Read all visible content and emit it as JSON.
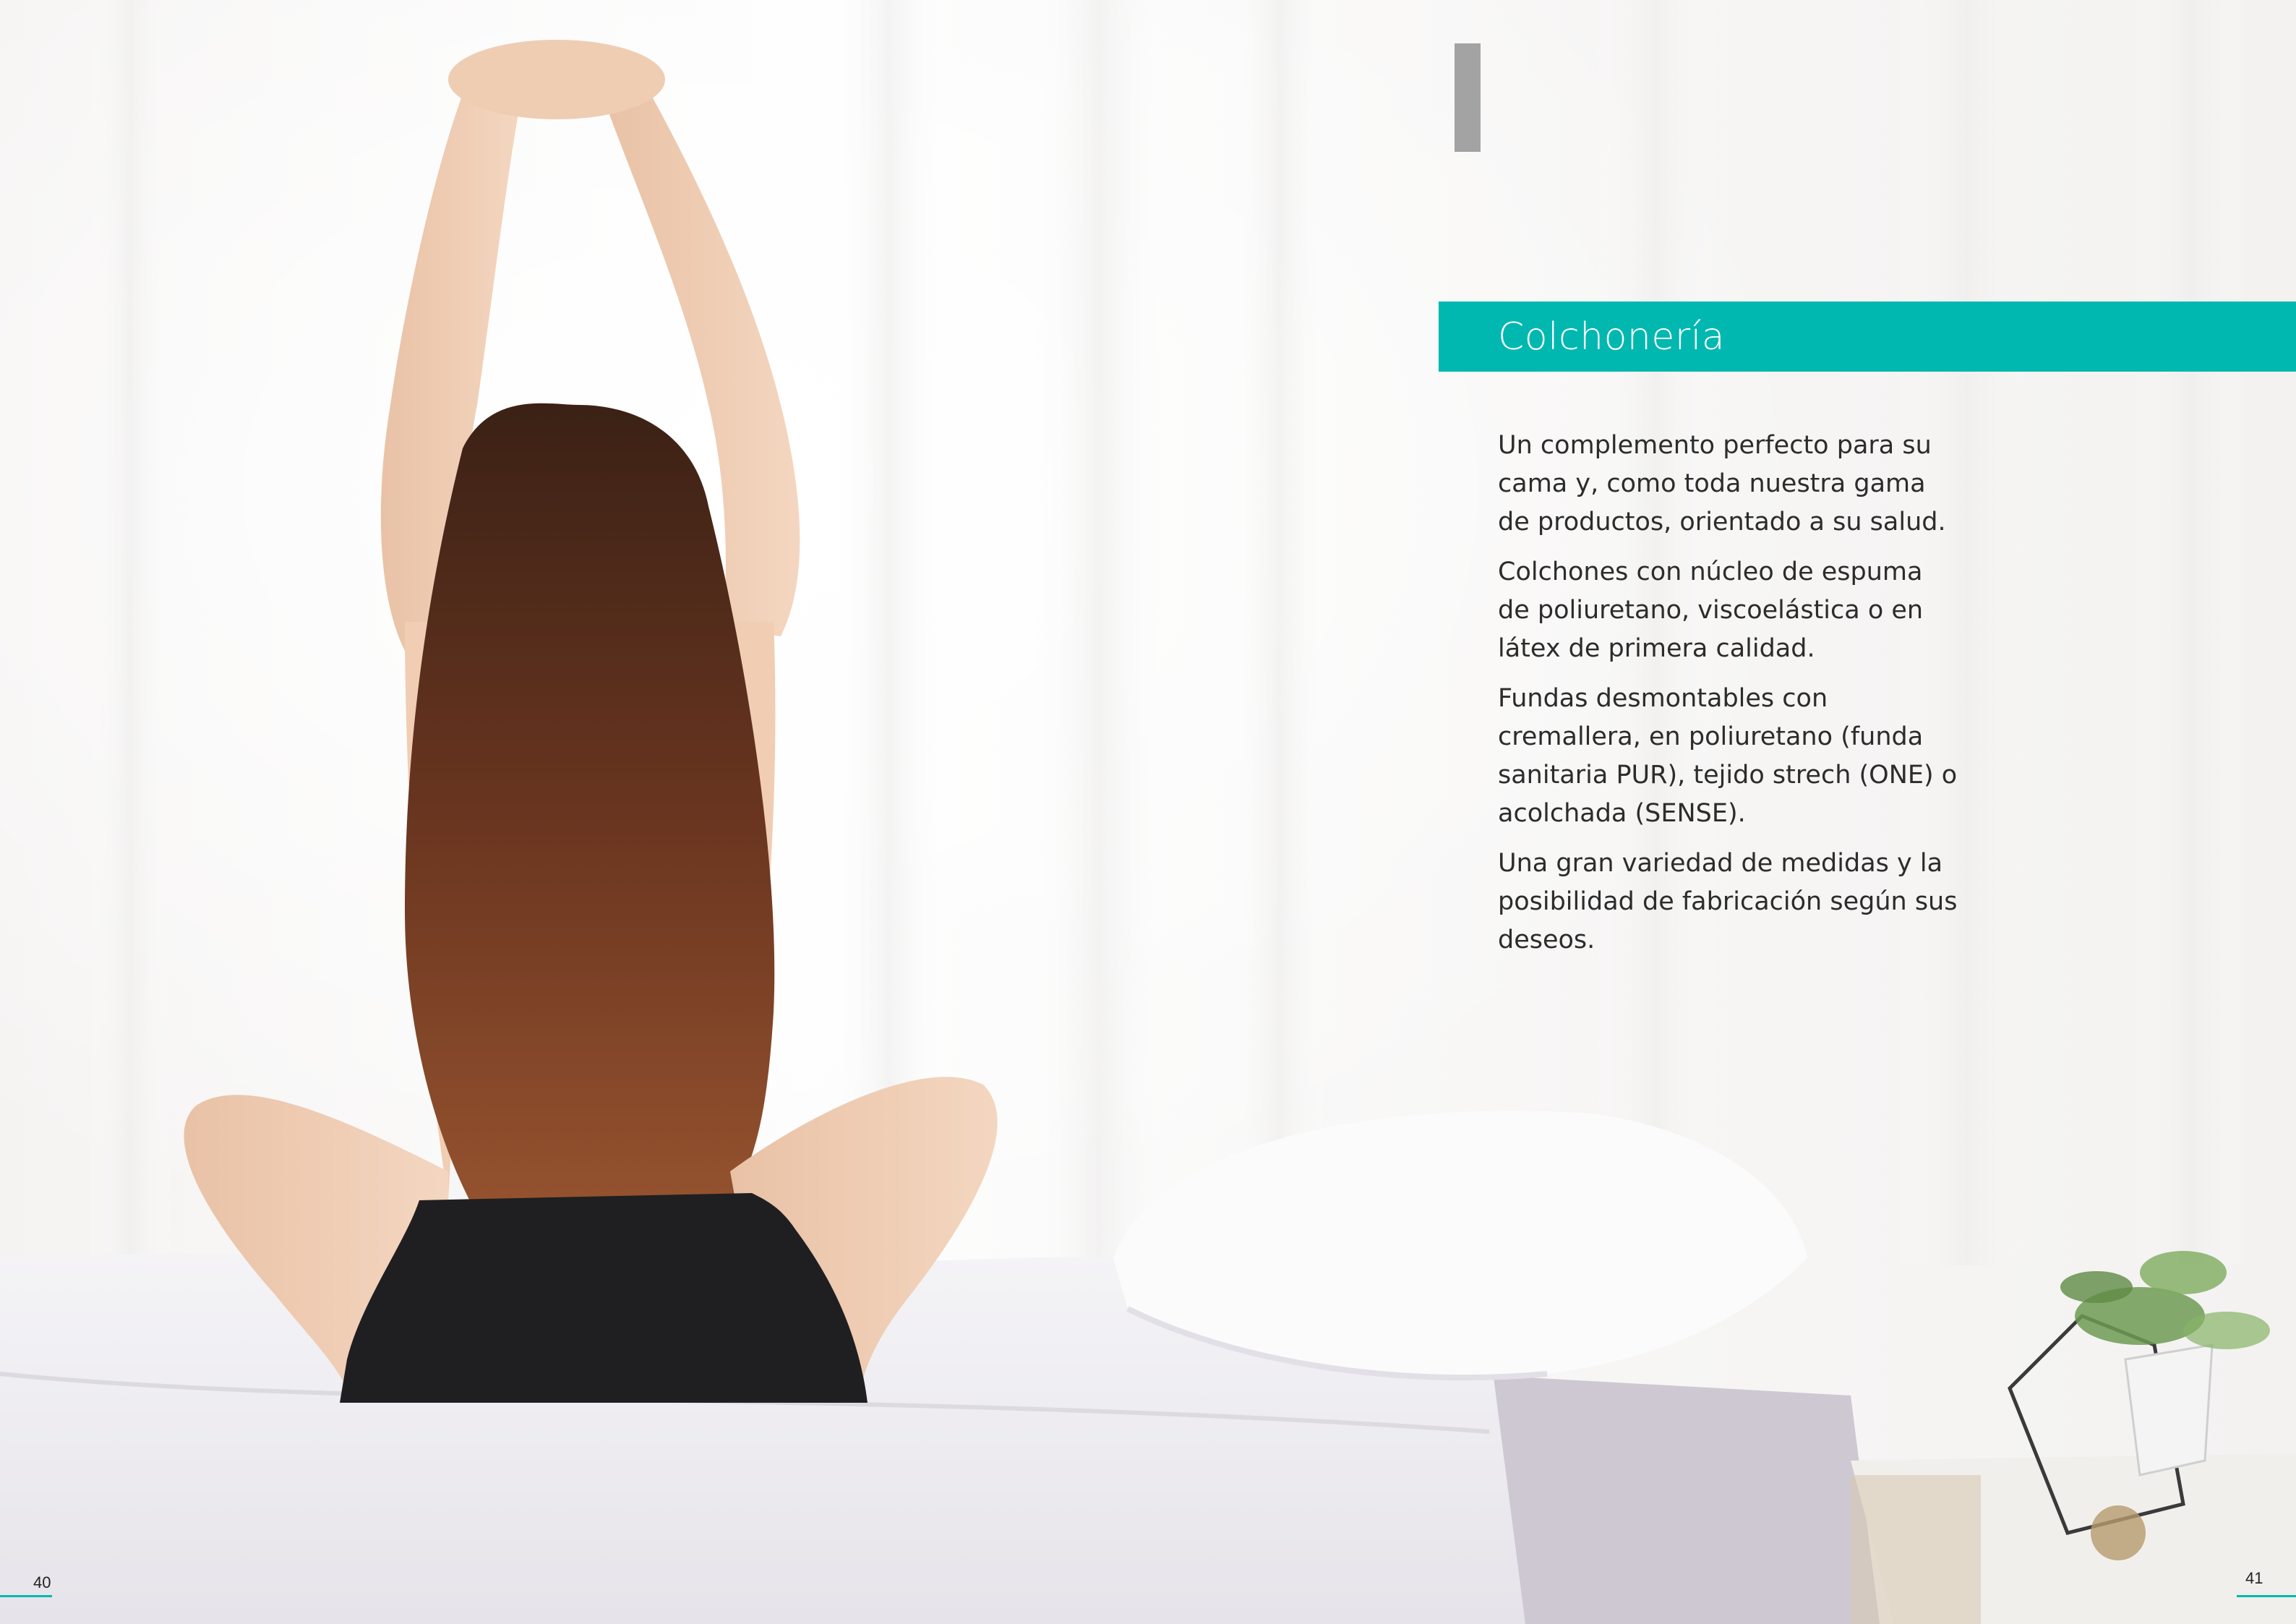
{
  "colors": {
    "accent": "#00b8b0",
    "text": "#2c2c2c"
  },
  "photo": {
    "subject": "person-stretching-on-bed-icon"
  },
  "header": {
    "title": "Colchonería"
  },
  "body": {
    "paragraphs": [
      "Un complemento perfecto para su cama y, como toda nuestra gama de productos, orientado a su salud.",
      "Colchones con núcleo de espuma de poliuretano, viscoelástica o en látex de primera calidad.",
      "Fundas desmontables con cremallera, en poliuretano (funda sanitaria PUR), tejido strech (ONE) o acolchada (SENSE).",
      "Una gran variedad de medidas y la posibilidad de fabricación según sus deseos."
    ]
  },
  "folio": {
    "left": "40",
    "right": "41"
  }
}
